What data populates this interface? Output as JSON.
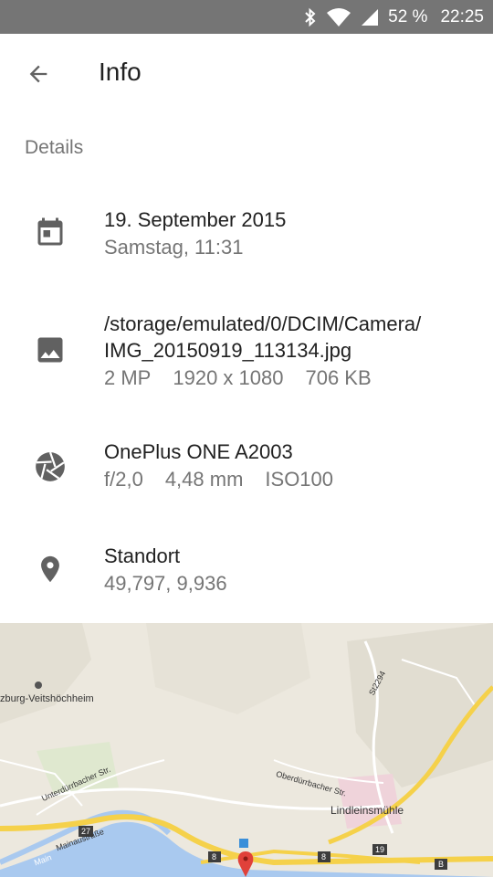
{
  "status_bar": {
    "battery": "52 %",
    "time": "22:25",
    "icons": [
      "bluetooth-icon",
      "wifi-icon",
      "signal-icon"
    ]
  },
  "header": {
    "title": "Info",
    "back_icon": "arrow-back-icon"
  },
  "details": {
    "section_label": "Details",
    "date": {
      "icon": "calendar-icon",
      "primary": "19. September 2015",
      "secondary": "Samstag, 11:31"
    },
    "file": {
      "icon": "image-icon",
      "path": "/storage/emulated/0/DCIM/Camera/",
      "filename": "IMG_20150919_113134.jpg",
      "megapixels": "2 MP",
      "resolution": "1920 x 1080",
      "size": "706 KB"
    },
    "camera": {
      "icon": "aperture-icon",
      "model": "OnePlus ONE A2003",
      "aperture": "f/2,0",
      "focal_length": "4,48 mm",
      "iso": "ISO100"
    },
    "location": {
      "icon": "location-pin-icon",
      "label": "Standort",
      "coordinates": "49,797, 9,936"
    }
  },
  "map": {
    "labels": {
      "place1": "zburg-Veitshöchheim",
      "place2": "Lindleinsmühle",
      "street1": "Unterdürrbacher Str.",
      "street2": "Oberdürrbacher Str.",
      "street3": "St2294",
      "street4": "Mainaustraße",
      "street5": "Main",
      "road27": "27",
      "road8a": "8",
      "road8b": "8",
      "road19": "19",
      "road_b": "B"
    },
    "colors": {
      "background": "#ece8de",
      "highway": "#f5d14a",
      "river": "#a9c9ef",
      "pin": "#e0413a"
    }
  }
}
